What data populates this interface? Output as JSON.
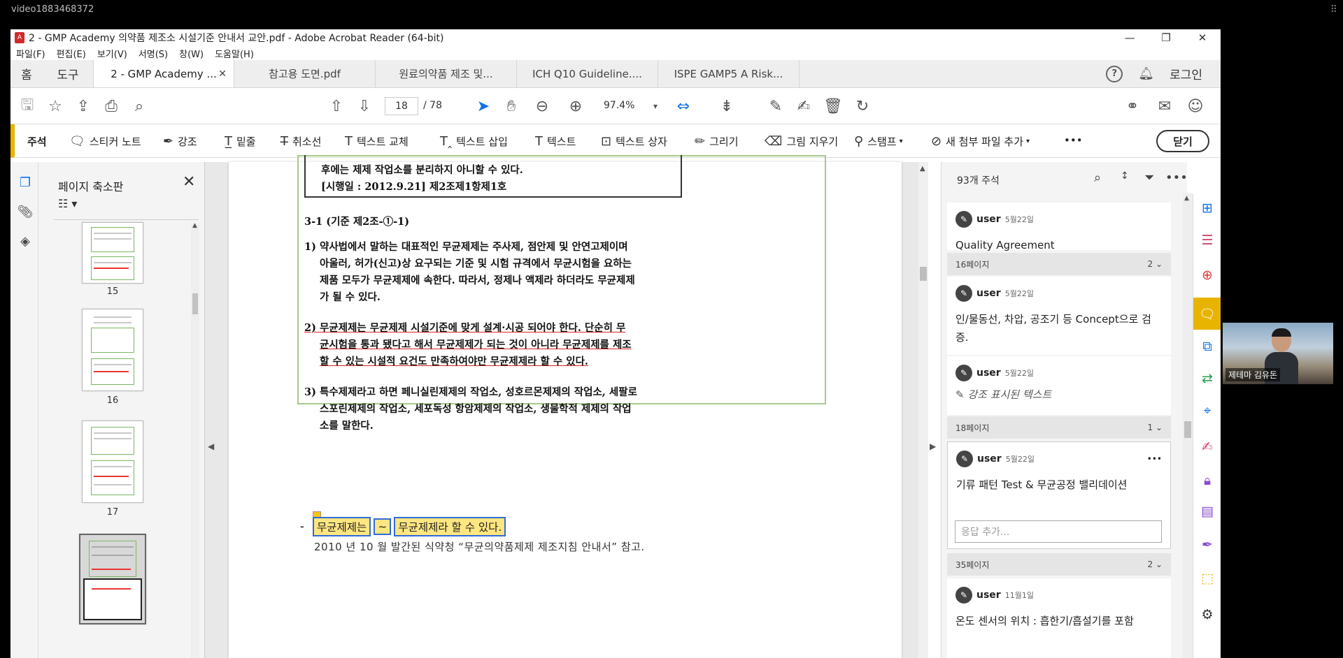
{
  "outer": {
    "label": "video1883468372"
  },
  "window": {
    "title": "2 - GMP Academy 의약품 제조소 시설기준 안내서 교안.pdf - Adobe Acrobat Reader (64-bit)",
    "minimize": "—",
    "restore": "❐",
    "close": "✕"
  },
  "menu": [
    "파일(F)",
    "편집(E)",
    "보기(V)",
    "서명(S)",
    "창(W)",
    "도움말(H)"
  ],
  "tabs": {
    "home": "홈",
    "tools": "도구",
    "docs": [
      {
        "label": "2 - GMP Academy ...",
        "active": true
      },
      {
        "label": "참고용 도면.pdf"
      },
      {
        "label": "원료의약품 제조 및..."
      },
      {
        "label": "ICH Q10 Guideline...."
      },
      {
        "label": "ISPE GAMP5 A Risk..."
      }
    ],
    "login": "로그인"
  },
  "toolbar": {
    "page_current": "18",
    "page_total": "/ 78",
    "zoom": "97.4%"
  },
  "comment_toolbar": {
    "title": "주석",
    "items": [
      "스티커 노트",
      "강조",
      "밑줄",
      "취소선",
      "텍스트 교체",
      "텍스트 삽입",
      "텍스트",
      "텍스트 상자",
      "그리기",
      "그림 지우기",
      "스탬프",
      "새 첨부 파일 추가"
    ],
    "more": "•••",
    "close": "닫기"
  },
  "thumbnails": {
    "title": "페이지 축소판",
    "pages": [
      "15",
      "16",
      "17"
    ]
  },
  "document": {
    "box_line1": "후에는 제제 작업소를 분리하지 아니할 수 있다.",
    "box_line2": "[시행일 : 2012.9.21] 제2조제1항제1호",
    "heading": "3-1 (기준 제2조-①-1)",
    "p1": [
      "1) 약사법에서 말하는 대표적인 무균제제는 주사제, 점안제 및 안연고제이며",
      "아울러, 허가(신고)상 요구되는 기준 및 시험 규격에서 무균시험을 요하는",
      "제품 모두가 무균제제에 속한다. 따라서, 정제나 액제라 하더라도 무균제제",
      "가 될 수 있다."
    ],
    "p2": [
      "2) 무균제제는 무균제제 시설기준에 맞게 설계·시공 되어야 한다. 단순히 무",
      "균시험을 통과 됐다고 해서 무균제제가 되는 것이 아니라 무균제제를 제조",
      "할 수 있는 시설적 요건도 만족하여야만 무균제제라 할 수 있다."
    ],
    "p3": [
      "3) 특수제제라고 하면 페니실린제제의 작업소, 성호르몬제제의 작업소, 세팔로",
      "스포린제제의 작업소, 세포독성 항암제제의 작업소, 생물학적 제제의 작업",
      "소를 말한다."
    ],
    "dash": "-",
    "hl_a": "무균제제는",
    "hl_b": "~",
    "hl_c": "무균제제라 할 수 있다.",
    "note": "2010 년 10 월 발간된 식약청 “무균의약품제제 제조지침 안내서” 참고."
  },
  "comments": {
    "count": "93개 주석",
    "cards": [
      {
        "user": "user",
        "date": "5월22일",
        "text": "Quality Agreement"
      },
      {
        "section": "16페이지",
        "count": "2"
      },
      {
        "user": "user",
        "date": "5월22일",
        "text": "인/물동선, 차압, 공조기 등 Concept으로 검증."
      },
      {
        "user": "user",
        "date": "5월22일",
        "text": "강조 표시된 텍스트"
      },
      {
        "section": "18페이지",
        "count": "1"
      },
      {
        "user": "user",
        "date": "5월22일",
        "text": "기류 패턴 Test & 무균공정 밸리데이션",
        "more": "•••"
      },
      {
        "section": "35페이지",
        "count": "2"
      },
      {
        "user": "user",
        "date": "11월1일",
        "text": "온도 센서의 위치 : 흡한기/흡설기를 포함"
      }
    ],
    "reply_placeholder": "응답 추가..."
  },
  "webcam": {
    "label": "제테마 김유돈"
  },
  "colors": {
    "accent": "#e8b400",
    "link": "#1473e6",
    "highlight": "#ffe680",
    "highlight_border": "#2f6cd8",
    "underline": "#dd2222"
  }
}
